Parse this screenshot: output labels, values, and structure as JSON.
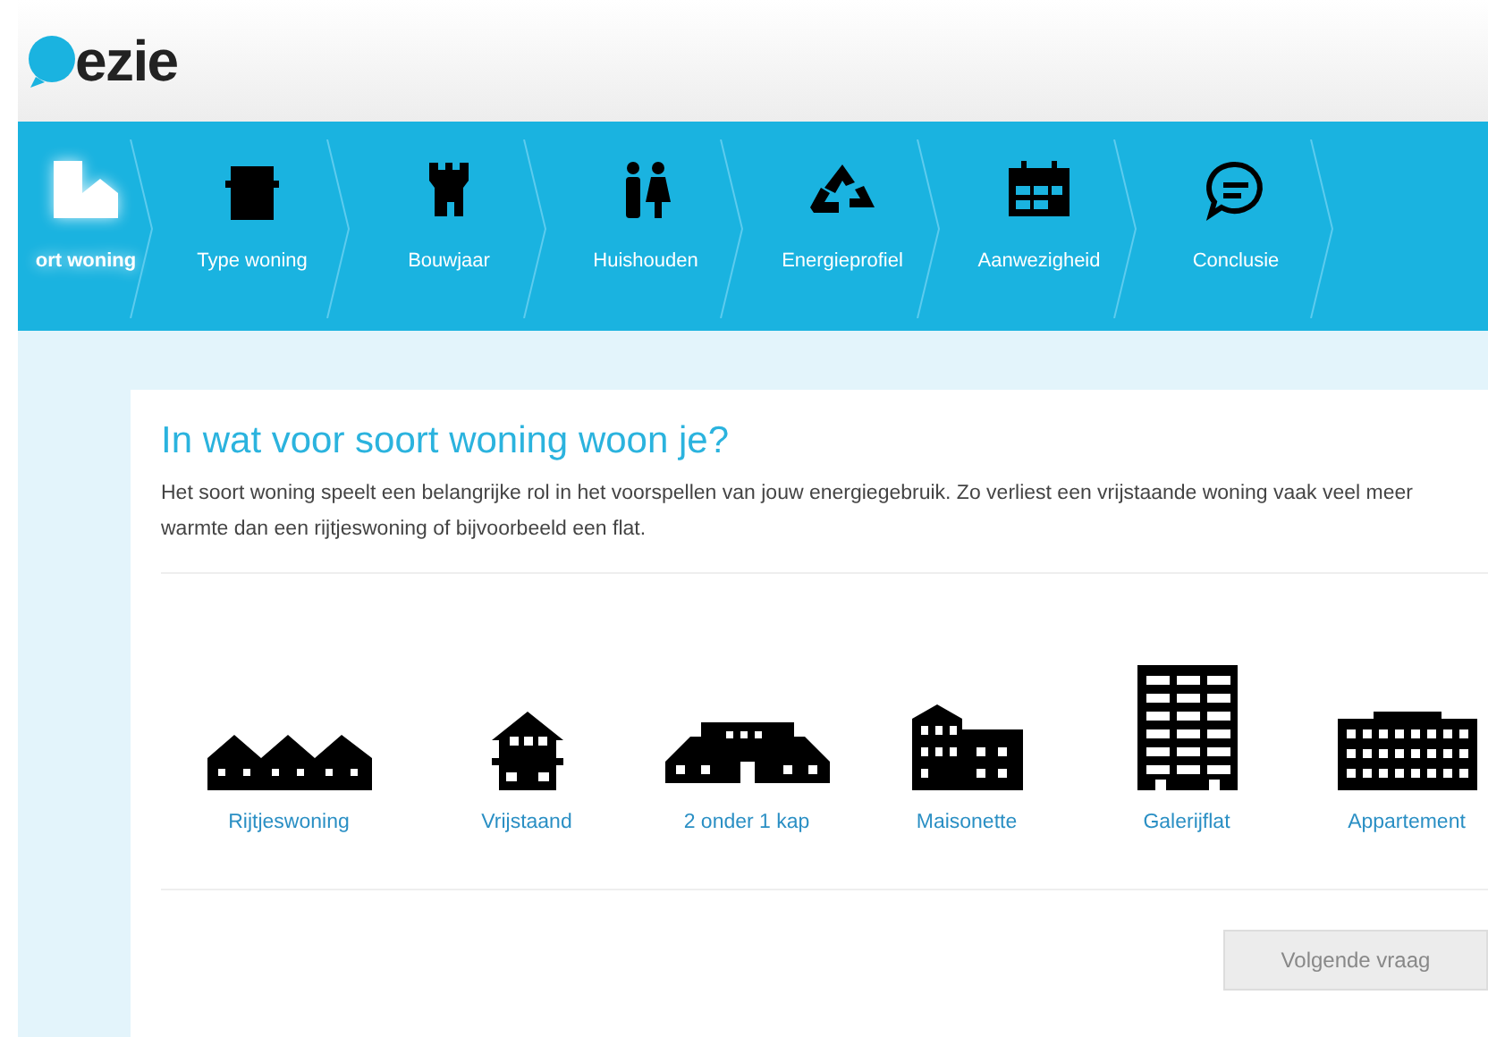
{
  "logo": "ezie",
  "steps": [
    {
      "label": "ort woning",
      "kind": "home",
      "selected": true
    },
    {
      "label": "Type woning",
      "kind": "building",
      "selected": false
    },
    {
      "label": "Bouwjaar",
      "kind": "castle",
      "selected": false
    },
    {
      "label": "Huishouden",
      "kind": "people",
      "selected": false
    },
    {
      "label": "Energieprofiel",
      "kind": "recycle",
      "selected": false
    },
    {
      "label": "Aanwezigheid",
      "kind": "calendar",
      "selected": false
    },
    {
      "label": "Conclusie",
      "kind": "chat",
      "selected": false
    }
  ],
  "question": {
    "title": "In wat voor soort woning woon je?",
    "text": "Het soort woning speelt een belangrijke rol in het voorspellen van jouw energiegebruik. Zo verliest een vrijstaande woning vaak veel meer warmte dan een rijtjeswoning of bijvoorbeeld een flat."
  },
  "options": [
    {
      "label": "Rijtjeswoning",
      "kind": "row"
    },
    {
      "label": "Vrijstaand",
      "kind": "detached"
    },
    {
      "label": "2 onder 1 kap",
      "kind": "semi"
    },
    {
      "label": "Maisonette",
      "kind": "maisonette"
    },
    {
      "label": "Galerijflat",
      "kind": "flat"
    },
    {
      "label": "Appartement",
      "kind": "apartment"
    }
  ],
  "next_button": {
    "label": "Volgende vraag",
    "disabled": true
  }
}
